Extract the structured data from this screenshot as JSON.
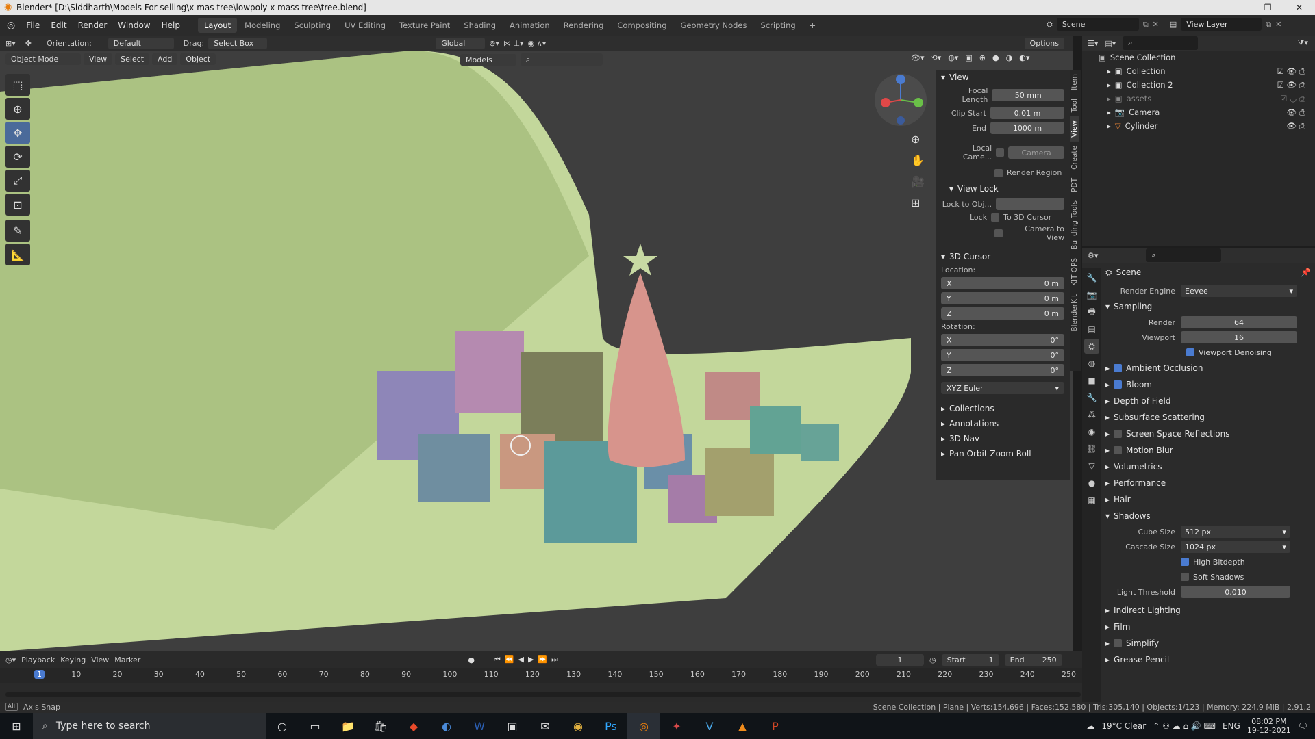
{
  "window": {
    "title": "Blender* [D:\\Siddharth\\Models For selling\\x mas tree\\lowpoly x mass tree\\tree.blend]",
    "controls": [
      "—",
      "❐",
      "✕"
    ]
  },
  "menu": [
    "File",
    "Edit",
    "Render",
    "Window",
    "Help"
  ],
  "workspaces": [
    "Layout",
    "Modeling",
    "Sculpting",
    "UV Editing",
    "Texture Paint",
    "Shading",
    "Animation",
    "Rendering",
    "Compositing",
    "Geometry Nodes",
    "Scripting"
  ],
  "workspace_active": "Layout",
  "scene_name": "Scene",
  "view_layer": "View Layer",
  "viewport_header": {
    "orientation_label": "Orientation:",
    "orientation_value": "Default",
    "drag_label": "Drag:",
    "drag_value": "Select Box",
    "transform": "Global",
    "options": "Options",
    "mode": "Object Mode",
    "menus": [
      "View",
      "Select",
      "Add",
      "Object"
    ],
    "collection": "Models"
  },
  "npanel": {
    "view_title": "View",
    "focal_length_label": "Focal Length",
    "focal_length": "50 mm",
    "clip_start_label": "Clip Start",
    "clip_start": "0.01 m",
    "end_label": "End",
    "clip_end": "1000 m",
    "local_camera_label": "Local Came...",
    "local_camera_value": "Camera",
    "render_region": "Render Region",
    "view_lock_title": "View Lock",
    "lock_to_obj_label": "Lock to Obj...",
    "lock_label": "Lock",
    "to_3d_cursor": "To 3D Cursor",
    "camera_to_view": "Camera to View",
    "cursor_title": "3D Cursor",
    "location_label": "Location:",
    "loc_x": "0 m",
    "loc_y": "0 m",
    "loc_z": "0 m",
    "rotation_label": "Rotation:",
    "rot_x": "0°",
    "rot_y": "0°",
    "rot_z": "0°",
    "rotation_mode": "XYZ Euler",
    "collapsed": [
      "Collections",
      "Annotations",
      "3D Nav",
      "Pan Orbit Zoom Roll"
    ]
  },
  "side_tabs": [
    "Item",
    "Tool",
    "View",
    "Create",
    "PDT",
    "Building Tools",
    "KIT OPS",
    "BlenderKit"
  ],
  "outliner": {
    "root": "Scene Collection",
    "items": [
      "Collection",
      "Collection 2",
      "assets",
      "Camera",
      "Cylinder"
    ]
  },
  "properties": {
    "context": "Scene",
    "render_engine_label": "Render Engine",
    "render_engine": "Eevee",
    "sampling": "Sampling",
    "render_label": "Render",
    "render_samples": "64",
    "viewport_label": "Viewport",
    "viewport_samples": "16",
    "viewport_denoising": "Viewport Denoising",
    "sections": [
      {
        "label": "Ambient Occlusion",
        "checkbox": true,
        "checked": true
      },
      {
        "label": "Bloom",
        "checkbox": true,
        "checked": true
      },
      {
        "label": "Depth of Field",
        "checkbox": false,
        "checked": false
      },
      {
        "label": "Subsurface Scattering",
        "checkbox": false,
        "checked": false
      },
      {
        "label": "Screen Space Reflections",
        "checkbox": true,
        "checked": false
      },
      {
        "label": "Motion Blur",
        "checkbox": true,
        "checked": false
      },
      {
        "label": "Volumetrics",
        "checkbox": false,
        "checked": false
      },
      {
        "label": "Performance",
        "checkbox": false,
        "checked": false
      },
      {
        "label": "Hair",
        "checkbox": false,
        "checked": false
      }
    ],
    "shadows": "Shadows",
    "cube_size_label": "Cube Size",
    "cube_size": "512 px",
    "cascade_size_label": "Cascade Size",
    "cascade_size": "1024 px",
    "high_bitdepth": "High Bitdepth",
    "soft_shadows": "Soft Shadows",
    "light_threshold_label": "Light Threshold",
    "light_threshold": "0.010",
    "after": [
      "Indirect Lighting",
      "Film",
      "Simplify",
      "Grease Pencil"
    ]
  },
  "timeline": {
    "menus": [
      "Playback",
      "Keying",
      "View",
      "Marker"
    ],
    "current_frame": "1",
    "start_label": "Start",
    "start": "1",
    "end_label": "End",
    "end": "250",
    "ticks": [
      "1",
      "10",
      "20",
      "30",
      "40",
      "50",
      "60",
      "70",
      "80",
      "90",
      "100",
      "110",
      "120",
      "130",
      "140",
      "150",
      "160",
      "170",
      "180",
      "190",
      "200",
      "210",
      "220",
      "230",
      "240",
      "250"
    ]
  },
  "status": {
    "left_key": "Alt",
    "left": "Axis Snap",
    "right": "Scene Collection | Plane | Verts:154,696 | Faces:152,580 | Tris:305,140 | Objects:1/123 | Memory: 224.9 MiB | 2.91.2"
  },
  "taskbar": {
    "search_placeholder": "Type here to search",
    "weather": "19°C  Clear",
    "lang": "ENG",
    "time": "08:02 PM",
    "date": "19-12-2021"
  },
  "colors": {
    "ground": "#c3d79b",
    "tree": "#d7948c",
    "accent": "#4a7bd0"
  }
}
